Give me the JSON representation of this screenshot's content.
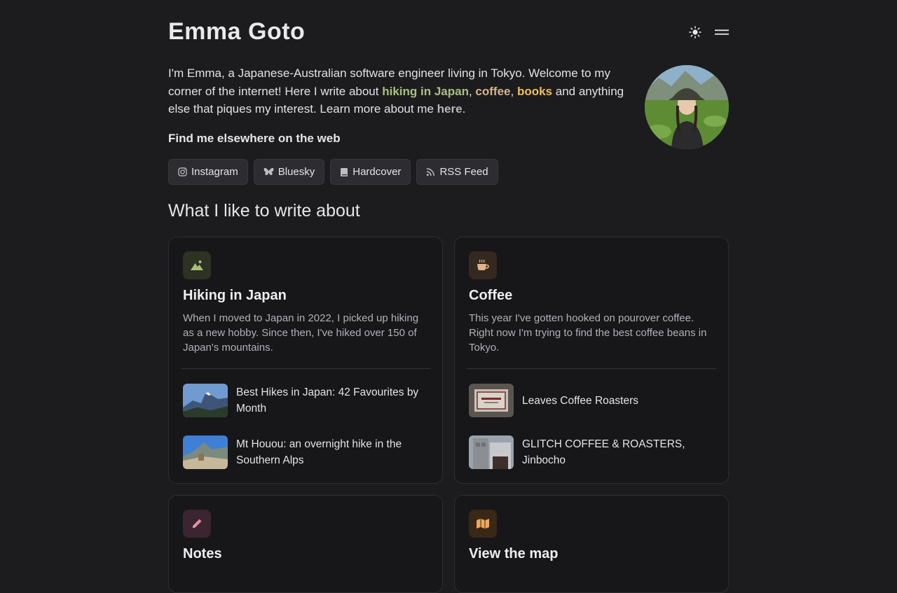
{
  "header": {
    "site_title": "Emma Goto",
    "theme_icon": "sun-icon",
    "menu_icon": "menu-icon"
  },
  "intro": {
    "part1": "I'm Emma, a Japanese-Australian software engineer living in Tokyo. Welcome to my corner of the internet! Here I write about ",
    "link_hiking": "hiking in Japan",
    "sep1": ", ",
    "link_coffee": "coffee",
    "sep2": ", ",
    "link_books": "books",
    "part2": " and anything else that piques my interest. Learn more about me ",
    "link_here": "here",
    "part3": "."
  },
  "elsewhere": {
    "title": "Find me elsewhere on the web",
    "links": [
      {
        "label": "Instagram",
        "icon": "instagram-icon"
      },
      {
        "label": "Bluesky",
        "icon": "butterfly-icon"
      },
      {
        "label": "Hardcover",
        "icon": "book-icon"
      },
      {
        "label": "RSS Feed",
        "icon": "rss-icon"
      }
    ]
  },
  "topics": {
    "title": "What I like to write about",
    "cards": [
      {
        "title": "Hiking in Japan",
        "icon": "mountain-icon",
        "icon_bg": "#2c3322",
        "icon_color": "#a9c07e",
        "description": "When I moved to Japan in 2022, I picked up hiking as a new hobby. Since then, I've hiked over 150 of Japan's mountains.",
        "posts": [
          {
            "title": "Best Hikes in Japan: 42 Favourites by Month"
          },
          {
            "title": "Mt Houou: an overnight hike in the Southern Alps"
          }
        ]
      },
      {
        "title": "Coffee",
        "icon": "coffee-cup-icon",
        "icon_bg": "#35291f",
        "icon_color": "#e0b58a",
        "description": "This year I've gotten hooked on pourover coffee. Right now I'm trying to find the best coffee beans in Tokyo.",
        "posts": [
          {
            "title": "Leaves Coffee Roasters"
          },
          {
            "title": "GLITCH COFFEE & ROASTERS, Jinbocho"
          }
        ]
      },
      {
        "title": "Notes",
        "icon": "pencil-icon",
        "icon_bg": "#3b2530",
        "icon_color": "#e98aa8"
      },
      {
        "title": "View the map",
        "icon": "map-icon",
        "icon_bg": "#3a2716",
        "icon_color": "#efa95a"
      }
    ]
  }
}
